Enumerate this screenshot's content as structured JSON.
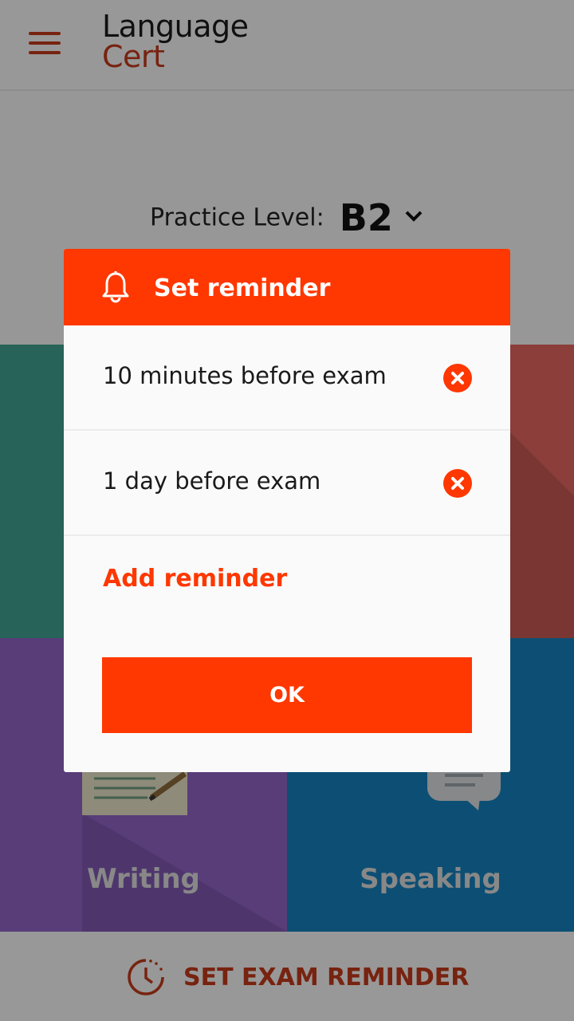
{
  "app": {
    "logo_line1": "Language",
    "logo_line2": "Cert",
    "brand_color": "#c0391b"
  },
  "level": {
    "label": "Practice Level:",
    "value": "B2"
  },
  "tiles": {
    "writing": "Writing",
    "speaking": "Speaking"
  },
  "bottom_bar": {
    "label": "SET EXAM REMINDER"
  },
  "dialog": {
    "title": "Set reminder",
    "accent": "#ff3700",
    "reminders": [
      {
        "label": "10 minutes before exam"
      },
      {
        "label": "1 day before exam"
      }
    ],
    "add_label": "Add reminder",
    "ok_label": "OK"
  },
  "icons": {
    "menu": "hamburger-menu-icon",
    "dropdown": "chevron-down-icon",
    "bell": "bell-icon",
    "remove": "close-circle-icon",
    "reminder": "clock-reminder-icon"
  }
}
